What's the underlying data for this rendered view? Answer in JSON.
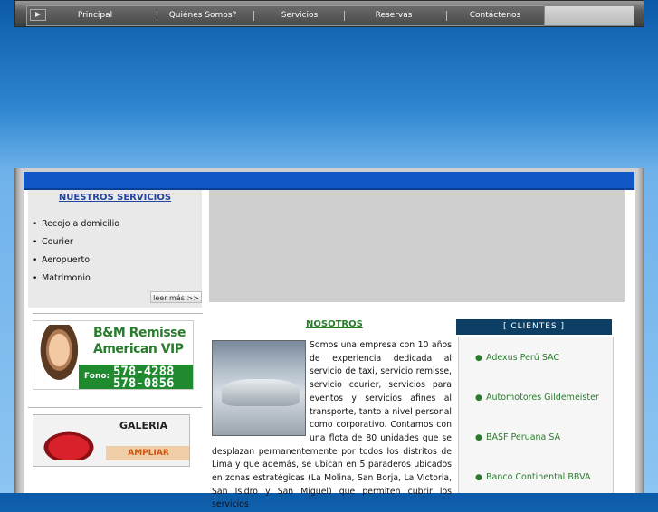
{
  "nav": {
    "items": [
      "Principal",
      "Quiénes Somos?",
      "Servicios",
      "Reservas",
      "Contáctenos"
    ]
  },
  "services": {
    "title": "NUESTROS SERVICIOS",
    "items": [
      "Recojo a domicilio",
      "Courier",
      "Aeropuerto",
      "Matrimonio"
    ],
    "more_label": "leer más >>"
  },
  "remisse_ad": {
    "line1": "B&M Remisse",
    "line2": "American VIP",
    "fono_label": "Fono:",
    "phone1": "578-4288",
    "phone2": "578-0856"
  },
  "galeria": {
    "title": "GALERIA",
    "button": "AMPLIAR"
  },
  "nosotros": {
    "title": "NOSOTROS",
    "text": "Somos una empresa con 10 años de experiencia dedicada al servicio de taxi, servicio remisse, servicio courier, servicios para eventos y servicios afines al transporte, tanto a nivel personal como corporativo. Contamos con una flota de 80 unidades que se desplazan permanentemente por todos los distritos de Lima y que además, se ubican en 5 paraderos ubicados en zonas estratégicas (La Molina, San Borja, La Victoria, San Isidro y San Miguel) que permiten cubrir los servicios"
  },
  "clientes": {
    "title": "[ CLIENTES ]",
    "items": [
      "Adexus Perú SAC",
      "Automotores Gildemeister",
      "BASF Peruana SA",
      "Banco Continental BBVA"
    ]
  },
  "colors": {
    "accent_blue": "#1157c8",
    "green": "#2b7b2e",
    "link_blue": "#2245a0"
  }
}
